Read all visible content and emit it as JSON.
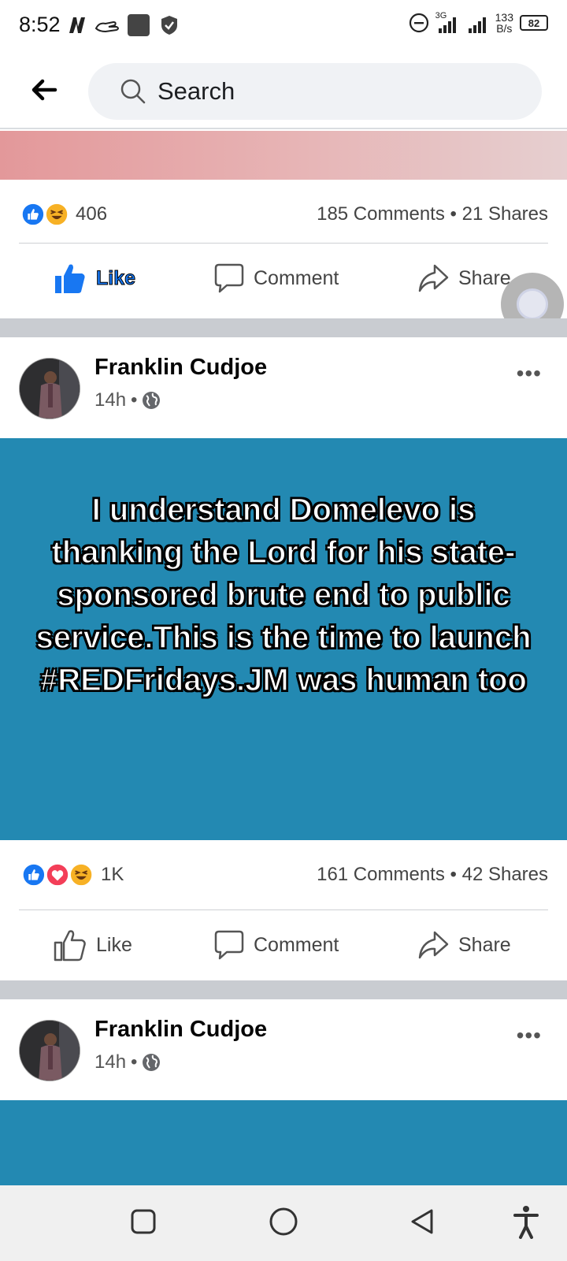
{
  "status_bar": {
    "time": "8:52",
    "network_label": "3G",
    "speed_value": "133",
    "speed_unit": "B/s",
    "battery": "82",
    "icons": [
      "netflix-icon",
      "hand-icon",
      "square-app-icon",
      "shield-icon",
      "dnd-icon",
      "signal-icon",
      "signal-icon-2",
      "battery-icon"
    ]
  },
  "header": {
    "search_placeholder": "Search"
  },
  "posts": [
    {
      "reaction_count": "406",
      "reactions": [
        "like",
        "haha"
      ],
      "comments": "185 Comments",
      "shares": "21 Shares",
      "actions": {
        "like": "Like",
        "comment": "Comment",
        "share": "Share"
      },
      "liked": true
    },
    {
      "author": "Franklin Cudjoe",
      "time": "14h",
      "separator": "•",
      "audience_icon": "globe-icon",
      "text": "I understand Domelevo is thanking the Lord for his state-sponsored brute end to public service.This is the time to launch #REDFridays.JM was human too",
      "background_color": "#2389b2",
      "reaction_count": "1K",
      "reactions": [
        "like",
        "love",
        "haha"
      ],
      "comments": "161 Comments",
      "shares": "42 Shares",
      "actions": {
        "like": "Like",
        "comment": "Comment",
        "share": "Share"
      },
      "liked": false
    },
    {
      "author": "Franklin Cudjoe",
      "time": "14h",
      "separator": "•",
      "audience_icon": "globe-icon",
      "background_color": "#2389b2"
    }
  ],
  "stats_separator": "•",
  "colors": {
    "facebook_blue": "#1877f2",
    "post_bg": "#2389b2",
    "divider": "#c9ccd1",
    "love_red": "#f33e58",
    "haha_yellow": "#f7b125"
  },
  "nav_bar": {
    "buttons": [
      "recents-square-icon",
      "home-circle-icon",
      "back-triangle-icon",
      "accessibility-icon"
    ]
  }
}
